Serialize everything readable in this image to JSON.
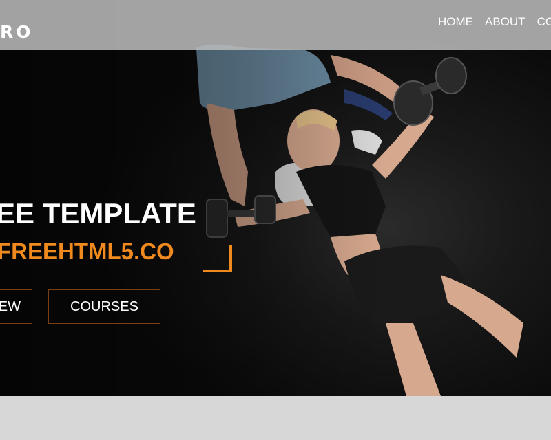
{
  "header": {
    "logo": "RO",
    "nav": [
      "HOME",
      "ABOUT",
      "CO"
    ]
  },
  "hero": {
    "headline": "EE TEMPLATE",
    "subline": "FREEHTML5.CO",
    "buttons": {
      "view": "EW",
      "courses": "COURSES"
    }
  },
  "colors": {
    "accent": "#f08a1e",
    "header_bg": "#bebebe",
    "hero_bg": "#0b0b0b"
  }
}
